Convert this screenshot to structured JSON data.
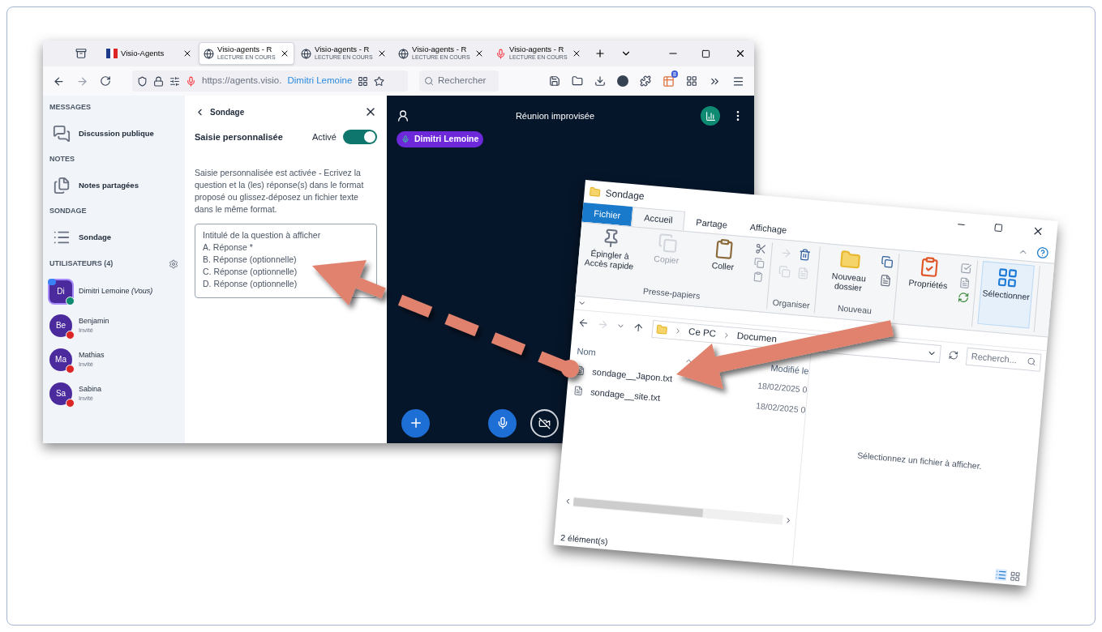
{
  "browser": {
    "tabs": [
      {
        "kind": "flag",
        "title": "Visio-Agents",
        "selected": false
      },
      {
        "kind": "globe",
        "title": "Visio-agents - R",
        "subtitle": "LECTURE EN COURS",
        "selected": true
      },
      {
        "kind": "globe",
        "title": "Visio-agents - R",
        "subtitle": "LECTURE EN COURS",
        "selected": false
      },
      {
        "kind": "globe",
        "title": "Visio-agents - R",
        "subtitle": "LECTURE EN COURS",
        "selected": false
      },
      {
        "kind": "mic",
        "title": "Visio-agents - R",
        "subtitle": "LECTURE EN COURS",
        "selected": false
      }
    ],
    "address": "https://agents.visio.",
    "address_user": "Dimitri Lemoine",
    "search": {
      "placeholder": "Rechercher"
    },
    "extension_badge": "8"
  },
  "sidebar": {
    "sections": [
      {
        "title": "MESSAGES",
        "items": [
          {
            "kind": "chat",
            "label": "Discussion publique"
          }
        ]
      },
      {
        "title": "NOTES",
        "items": [
          {
            "kind": "notes",
            "label": "Notes partagées"
          }
        ]
      },
      {
        "title": "SONDAGE",
        "items": [
          {
            "kind": "poll",
            "label": "Sondage"
          }
        ]
      }
    ],
    "users_title": "UTILISATEURS (4)",
    "users": [
      {
        "initials": "Di",
        "name": "Dimitri Lemoine *(Vous)*",
        "muted": false,
        "presenter": true
      },
      {
        "initials": "Be",
        "name": "Benjamin",
        "role": "Invité",
        "muted": true,
        "presenter": false
      },
      {
        "initials": "Ma",
        "name": "Mathias",
        "role": "Invité",
        "muted": true,
        "presenter": false
      },
      {
        "initials": "Sa",
        "name": "Sabina",
        "role": "Invité",
        "muted": true,
        "presenter": false
      }
    ]
  },
  "poll_panel": {
    "back": "Sondage",
    "option_title": "Saisie personnalisée",
    "toggle_label": "Activé",
    "toggle_on": true,
    "description": "Saisie personnalisée est activée - Ecrivez la question et la (les) réponse(s) dans le format proposé ou glissez-déposez un fichier texte dans le même format.",
    "textarea_lines": [
      "Intitulé de la question à afficher",
      "A. Réponse *",
      "B. Réponse (optionnelle)",
      "C. Réponse (optionnelle)",
      "D. Réponse (optionnelle)"
    ]
  },
  "meeting": {
    "title": "Réunion improvisée",
    "speaker": "Dimitri Lemoine"
  },
  "explorer": {
    "title": "Sondage",
    "ribbon_tabs": [
      {
        "kind": "file",
        "label": "Fichier",
        "selected": false
      },
      {
        "kind": "tab",
        "label": "Accueil",
        "selected": true
      },
      {
        "kind": "tab",
        "label": "Partage",
        "selected": false
      },
      {
        "kind": "tab",
        "label": "Affichage",
        "selected": false
      }
    ],
    "groups": [
      {
        "label": "Presse-papiers",
        "buttons": [
          {
            "kind": "pin",
            "label": "Épingler à Accès rapide",
            "disabled": false
          },
          {
            "kind": "copy",
            "label": "Copier",
            "disabled": true
          },
          {
            "kind": "paste",
            "label": "Coller",
            "disabled": false
          }
        ]
      },
      {
        "label": "Organiser"
      },
      {
        "label": "Nouveau",
        "buttons": [
          {
            "kind": "folder",
            "label": "Nouveau dossier",
            "disabled": false
          }
        ]
      },
      {
        "buttons": [
          {
            "kind": "properties",
            "label": "Propriétés",
            "disabled": false
          }
        ]
      },
      {
        "buttons": [
          {
            "kind": "select",
            "label": "Sélectionner",
            "disabled": false
          }
        ]
      }
    ],
    "path": [
      "Ce PC",
      "Documen"
    ],
    "search": {
      "placeholder": "Recherch..."
    },
    "columns": [
      "Nom",
      "Modifié le"
    ],
    "files": [
      {
        "name": "sondage__Japon.txt",
        "modified": "18/02/2025 0"
      },
      {
        "name": "sondage__site.txt",
        "modified": "18/02/2025 0"
      }
    ],
    "preview": "Sélectionnez un fichier à afficher.",
    "status": "2 élément(s)"
  }
}
